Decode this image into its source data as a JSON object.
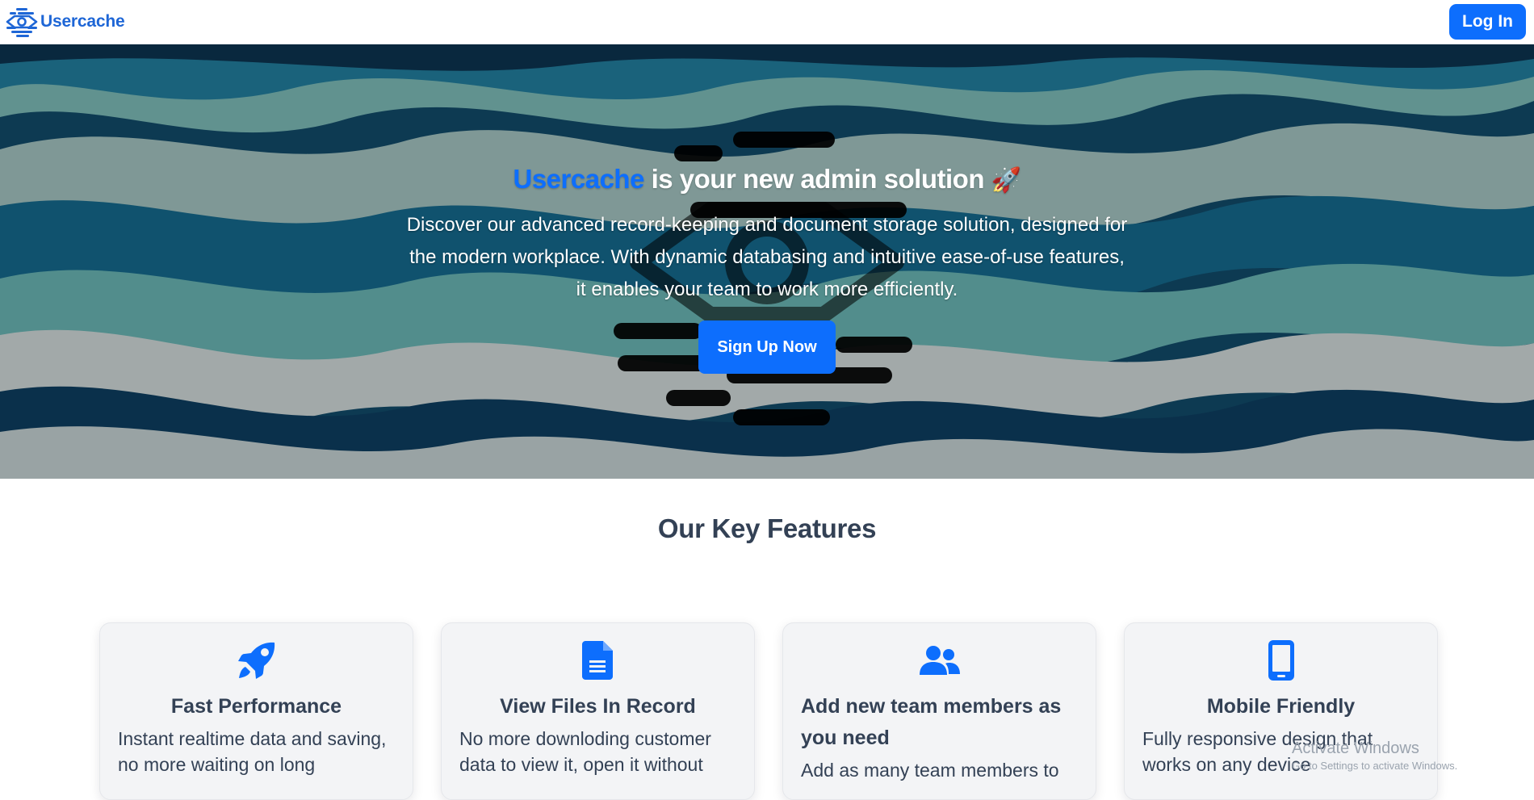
{
  "brand": {
    "name": "Usercache",
    "logo_icon": "usercache-eye-logo-icon",
    "color": "#1e66d6"
  },
  "nav": {
    "login_label": "Log In"
  },
  "hero": {
    "title_accent": "Usercache",
    "title_rest": " is your new admin solution ",
    "title_emoji": "🚀",
    "description": "Discover our advanced record-keeping and document storage solution, designed for the modern workplace. With dynamic databasing and intuitive ease-of-use features, it enables your team to work more efficiently.",
    "signup_label": "Sign Up Now"
  },
  "features": {
    "title": "Our Key Features",
    "cards": [
      {
        "icon": "rocket-icon",
        "title": "Fast Performance",
        "text": "Instant realtime data and saving, no more waiting on long"
      },
      {
        "icon": "document-icon",
        "title": "View Files In Record",
        "text": "No more downloding customer data to view it, open it without"
      },
      {
        "icon": "users-icon",
        "title": "Add new team members as you need",
        "text": "Add as many team members to"
      },
      {
        "icon": "mobile-icon",
        "title": "Mobile Friendly",
        "text": "Fully responsive design that works on any device"
      }
    ]
  },
  "watermark": {
    "line1": "Activate Windows",
    "line2": "Go to Settings to activate Windows."
  },
  "colors": {
    "primary": "#0d6efd",
    "text": "#334155",
    "card_bg": "#f3f4f6"
  }
}
